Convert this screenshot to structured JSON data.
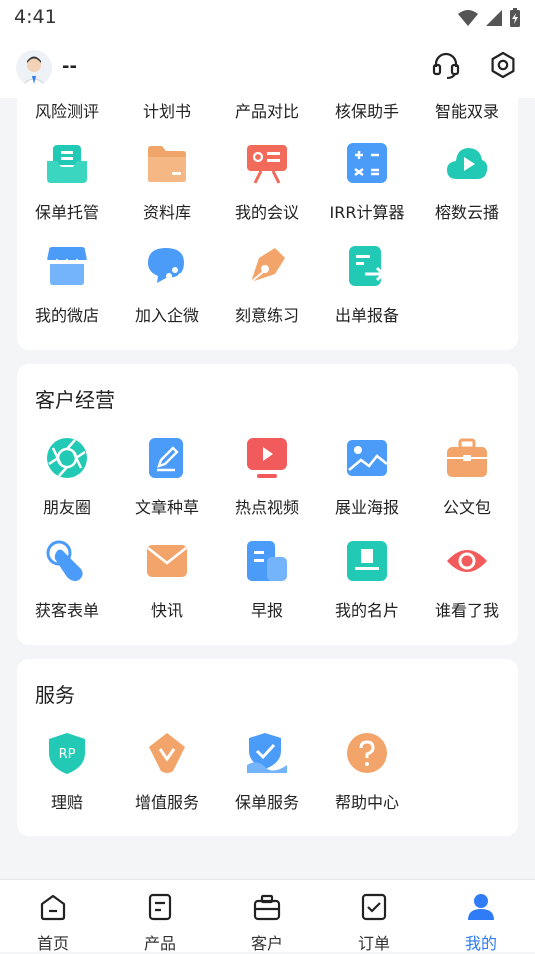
{
  "status_bar": {
    "time": "4:41"
  },
  "header": {
    "username": "--"
  },
  "tools_card": {
    "rows": [
      [
        {
          "label": "风险测评"
        },
        {
          "label": "计划书"
        },
        {
          "label": "产品对比"
        },
        {
          "label": "核保助手"
        },
        {
          "label": "智能双录"
        }
      ],
      [
        {
          "label": "保单托管",
          "icon": "tray-icon"
        },
        {
          "label": "资料库",
          "icon": "folder-icon"
        },
        {
          "label": "我的会议",
          "icon": "meeting-icon"
        },
        {
          "label": "IRR计算器",
          "icon": "calculator-icon"
        },
        {
          "label": "榕数云播",
          "icon": "cloud-play-icon"
        }
      ],
      [
        {
          "label": "我的微店",
          "icon": "shop-icon"
        },
        {
          "label": "加入企微",
          "icon": "chat-bubble-icon"
        },
        {
          "label": "刻意练习",
          "icon": "pen-nib-icon"
        },
        {
          "label": "出单报备",
          "icon": "document-arrow-icon"
        }
      ]
    ]
  },
  "customer_card": {
    "title": "客户经营",
    "items": [
      {
        "label": "朋友圈",
        "icon": "aperture-icon"
      },
      {
        "label": "文章种草",
        "icon": "edit-document-icon"
      },
      {
        "label": "热点视频",
        "icon": "video-play-icon"
      },
      {
        "label": "展业海报",
        "icon": "image-icon"
      },
      {
        "label": "公文包",
        "icon": "briefcase-icon"
      },
      {
        "label": "获客表单",
        "icon": "touch-icon"
      },
      {
        "label": "快讯",
        "icon": "envelope-icon"
      },
      {
        "label": "早报",
        "icon": "newspaper-icon"
      },
      {
        "label": "我的名片",
        "icon": "card-icon"
      },
      {
        "label": "谁看了我",
        "icon": "eye-icon"
      }
    ]
  },
  "service_card": {
    "title": "服务",
    "items": [
      {
        "label": "理赔",
        "icon": "rp-shield-icon",
        "badge": "RP"
      },
      {
        "label": "增值服务",
        "icon": "diamond-v-icon"
      },
      {
        "label": "保单服务",
        "icon": "check-shield-icon"
      },
      {
        "label": "帮助中心",
        "icon": "question-icon"
      }
    ]
  },
  "tabbar": {
    "tabs": [
      {
        "label": "首页",
        "icon": "home-icon"
      },
      {
        "label": "产品",
        "icon": "product-icon"
      },
      {
        "label": "客户",
        "icon": "customer-icon"
      },
      {
        "label": "订单",
        "icon": "order-icon"
      },
      {
        "label": "我的",
        "icon": "profile-icon",
        "active": true
      }
    ]
  },
  "colors": {
    "accent": "#2f7cf6",
    "teal": "#22c9b4",
    "orange": "#f3a46a",
    "red": "#f25b5b"
  }
}
